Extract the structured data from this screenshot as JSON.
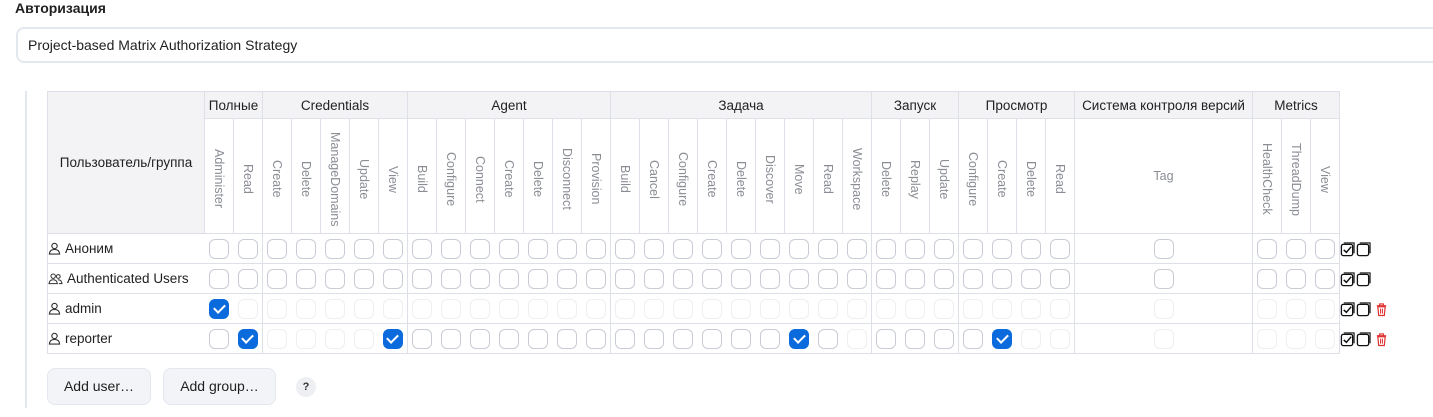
{
  "section": {
    "title": "Авторизация"
  },
  "strategy": {
    "selected": "Project-based Matrix Authorization Strategy"
  },
  "matrix": {
    "user_header": "Пользователь/группа",
    "groups": [
      {
        "label": "Полные",
        "perms": [
          "Administer",
          "Read"
        ]
      },
      {
        "label": "Credentials",
        "perms": [
          "Create",
          "Delete",
          "ManageDomains",
          "Update",
          "View"
        ]
      },
      {
        "label": "Agent",
        "perms": [
          "Build",
          "Configure",
          "Connect",
          "Create",
          "Delete",
          "Disconnect",
          "Provision"
        ]
      },
      {
        "label": "Задача",
        "perms": [
          "Build",
          "Cancel",
          "Configure",
          "Create",
          "Delete",
          "Discover",
          "Move",
          "Read",
          "Workspace"
        ]
      },
      {
        "label": "Запуск",
        "perms": [
          "Delete",
          "Replay",
          "Update"
        ]
      },
      {
        "label": "Просмотр",
        "perms": [
          "Configure",
          "Create",
          "Delete",
          "Read"
        ]
      },
      {
        "label": "Система контроля версий",
        "perms": [
          "Tag"
        ]
      },
      {
        "label": "Metrics",
        "perms": [
          "HealthCheck",
          "ThreadDump",
          "View"
        ]
      }
    ],
    "rows": [
      {
        "name": "Аноним",
        "kind": "user",
        "checked": [],
        "faded": [],
        "deletable": false
      },
      {
        "name": "Authenticated Users",
        "kind": "group",
        "checked": [],
        "faded": [],
        "deletable": false
      },
      {
        "name": "admin",
        "kind": "user",
        "checked": [
          0
        ],
        "faded": "all-except-checked",
        "deletable": true
      },
      {
        "name": "reporter",
        "kind": "user",
        "checked": [
          1,
          6,
          20,
          27
        ],
        "faded": [
          1,
          2,
          3,
          4,
          5,
          6,
          22,
          27,
          28,
          29,
          30,
          31,
          32,
          33,
          34,
          35
        ],
        "deletable": true
      }
    ]
  },
  "buttons": {
    "add_user": "Add user…",
    "add_group": "Add group…",
    "help": "?"
  },
  "colors": {
    "accent": "#0b6bdc",
    "delete": "#e03131",
    "header_bg": "#f3f3f6",
    "border": "#dde0e6"
  }
}
